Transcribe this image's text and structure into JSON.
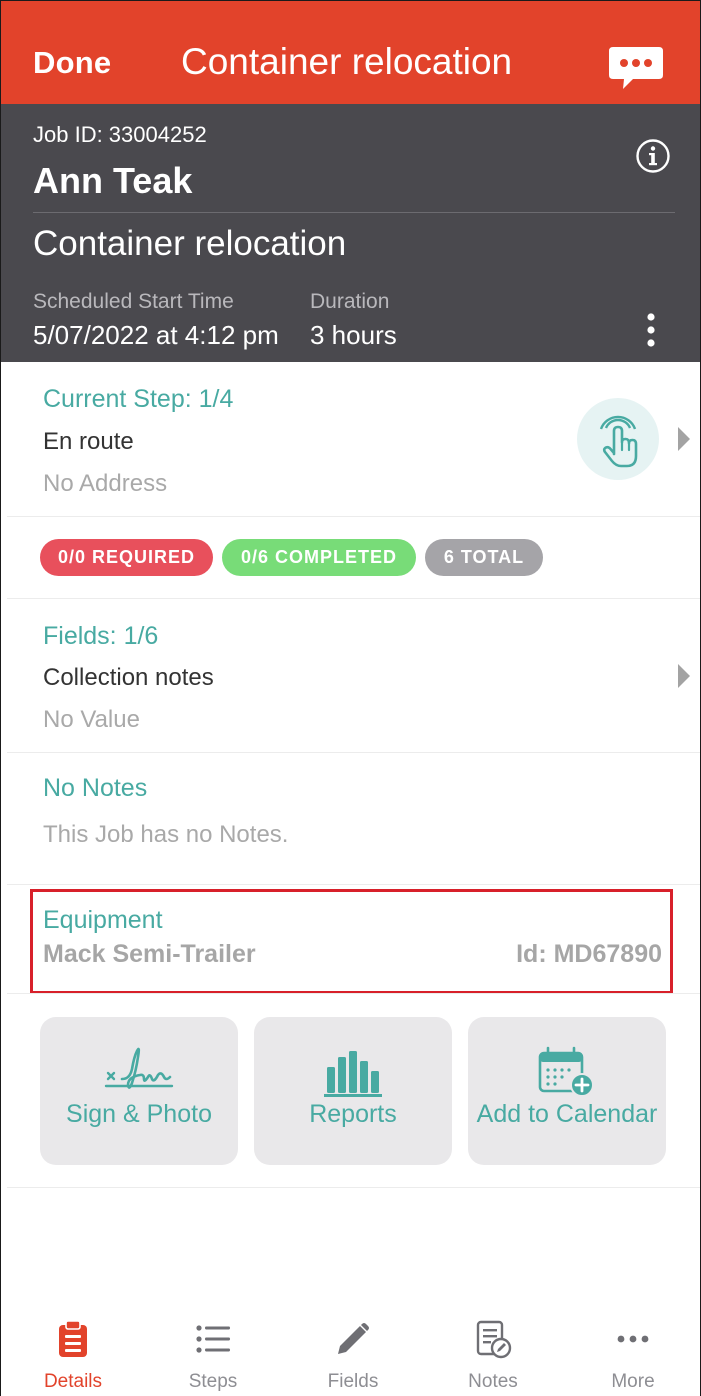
{
  "navbar": {
    "done_label": "Done",
    "title": "Container relocation",
    "chat_icon": "chat-bubble-icon",
    "accent_color": "#e2432b"
  },
  "header": {
    "job_id": "Job ID: 33004252",
    "customer_name": "Ann Teak",
    "job_title": "Container relocation",
    "scheduled_label": "Scheduled Start Time",
    "scheduled_value": "5/07/2022 at 4:12 pm",
    "duration_label": "Duration",
    "duration_value": "3 hours",
    "background_color": "#4a494e"
  },
  "current_step": {
    "heading": "Current Step: 1/4",
    "step_name": "En route",
    "address": "No Address"
  },
  "badges": {
    "required": "0/0 REQUIRED",
    "completed": "0/6 COMPLETED",
    "total": "6 TOTAL"
  },
  "fields": {
    "heading": "Fields: 1/6",
    "field_name": "Collection notes",
    "field_value": "No Value"
  },
  "notes": {
    "heading": "No Notes",
    "text": "This Job has no Notes."
  },
  "equipment": {
    "heading": "Equipment",
    "name": "Mack Semi-Trailer",
    "id": "Id: MD67890"
  },
  "actions": [
    {
      "label": "Sign & Photo",
      "icon": "signature-icon"
    },
    {
      "label": "Reports",
      "icon": "bar-chart-icon"
    },
    {
      "label": "Add to Calendar",
      "icon": "calendar-add-icon"
    }
  ],
  "tabs": [
    {
      "label": "Details",
      "icon": "clipboard-icon",
      "active": true
    },
    {
      "label": "Steps",
      "icon": "list-icon",
      "active": false
    },
    {
      "label": "Fields",
      "icon": "pencil-icon",
      "active": false
    },
    {
      "label": "Notes",
      "icon": "notes-icon",
      "active": false
    },
    {
      "label": "More",
      "icon": "ellipsis-icon",
      "active": false
    }
  ]
}
